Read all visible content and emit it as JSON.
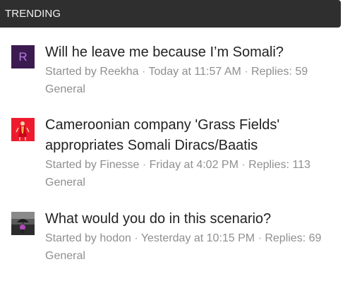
{
  "header": {
    "title": "TRENDING"
  },
  "threads": [
    {
      "avatar": {
        "type": "letter",
        "letter": "R",
        "bg": "#3b1b4f",
        "fg": "#b77be0"
      },
      "title": "Will he leave me because I’m Somali?",
      "started_by_prefix": "Started by",
      "author": "Reekha",
      "time": "Today at 11:57 AM",
      "replies_label": "Replies:",
      "replies": "59",
      "forum": "General"
    },
    {
      "avatar": {
        "type": "image",
        "icon": "red-figure-avatar",
        "bg": "#e8102a"
      },
      "title_line1": "Cameroonian company 'Grass Fields'",
      "title_line2": "appropriates Somali Diracs/Baatis",
      "started_by_prefix": "Started by",
      "author": "Finesse",
      "time": "Friday at 4:02 PM",
      "replies_label": "Replies:",
      "replies": "113",
      "forum": "General"
    },
    {
      "avatar": {
        "type": "image",
        "icon": "umbrella-figure-avatar",
        "bg": "#444444"
      },
      "title": "What would you do in this scenario?",
      "started_by_prefix": "Started by",
      "author": "hodon",
      "time": "Yesterday at 10:15 PM",
      "replies_label": "Replies:",
      "replies": "69",
      "forum": "General"
    }
  ],
  "colors": {
    "header_bg": "#2f2f2f",
    "header_text": "#f2f2f2",
    "title_text": "#222222",
    "meta_text": "#8f8f8f"
  }
}
